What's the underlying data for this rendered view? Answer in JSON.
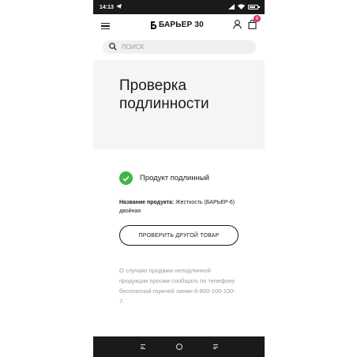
{
  "status_bar": {
    "time": "14:13",
    "battery_level": 0.8,
    "icons": [
      "telegram-send-icon",
      "signal-icon",
      "wifi-icon",
      "battery-icon"
    ]
  },
  "header": {
    "logo_text": "БАРЬЕР 30",
    "icons": [
      "menu-icon",
      "user-icon",
      "cart-icon"
    ],
    "cart_count": "0"
  },
  "search": {
    "placeholder": "поиск"
  },
  "hero": {
    "title": "Проверка подлинности"
  },
  "result": {
    "status_text": "Продукт подлинный",
    "status_color": "#3fb549"
  },
  "product": {
    "name_label": "Название продукта:",
    "name_value": "Жесткость (БАРЬЕР-6) двойная"
  },
  "actions": {
    "check_another_label": "ПРОВЕРИТЬ ДРУГОЙ ТОВАР"
  },
  "note": {
    "text": "О случаях продажи неподлинной продукции просим сообщать по телефону бесплатной горячей линии 8-800-100-100-7."
  },
  "colors": {
    "accent": "#e0307a",
    "hero_bg": "#f5f5f5",
    "nav_bg": "#1a1a1a"
  }
}
